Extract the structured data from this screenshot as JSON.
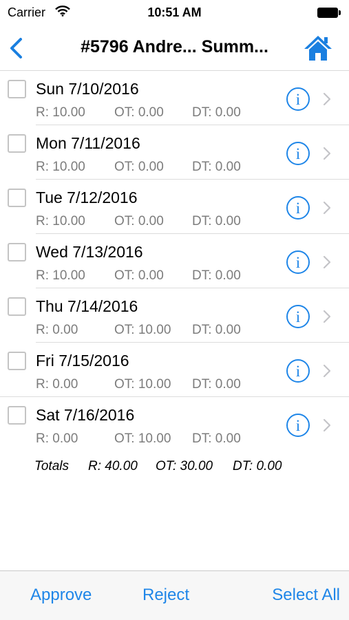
{
  "status": {
    "carrier": "Carrier",
    "time": "10:51 AM"
  },
  "nav": {
    "title": "#5796  Andre... Summ..."
  },
  "rows": [
    {
      "day": "Sun 7/10/2016",
      "r": "R: 10.00",
      "ot": "OT: 0.00",
      "dt": "DT: 0.00"
    },
    {
      "day": "Mon 7/11/2016",
      "r": "R: 10.00",
      "ot": "OT: 0.00",
      "dt": "DT: 0.00"
    },
    {
      "day": "Tue 7/12/2016",
      "r": "R: 10.00",
      "ot": "OT: 0.00",
      "dt": "DT: 0.00"
    },
    {
      "day": "Wed 7/13/2016",
      "r": "R: 10.00",
      "ot": "OT: 0.00",
      "dt": "DT: 0.00"
    },
    {
      "day": "Thu 7/14/2016",
      "r": "R: 0.00",
      "ot": "OT: 10.00",
      "dt": "DT: 0.00"
    },
    {
      "day": "Fri 7/15/2016",
      "r": "R: 0.00",
      "ot": "OT: 10.00",
      "dt": "DT: 0.00"
    },
    {
      "day": "Sat 7/16/2016",
      "r": "R: 0.00",
      "ot": "OT: 10.00",
      "dt": "DT: 0.00"
    }
  ],
  "totals": {
    "label": "Totals",
    "r": "R: 40.00",
    "ot": "OT: 30.00",
    "dt": "DT: 0.00"
  },
  "toolbar": {
    "approve": "Approve",
    "reject": "Reject",
    "select_all": "Select All"
  },
  "colors": {
    "accent": "#1f86e8",
    "home": "#1a7fe0",
    "secondary_text": "#7c7c7c"
  }
}
